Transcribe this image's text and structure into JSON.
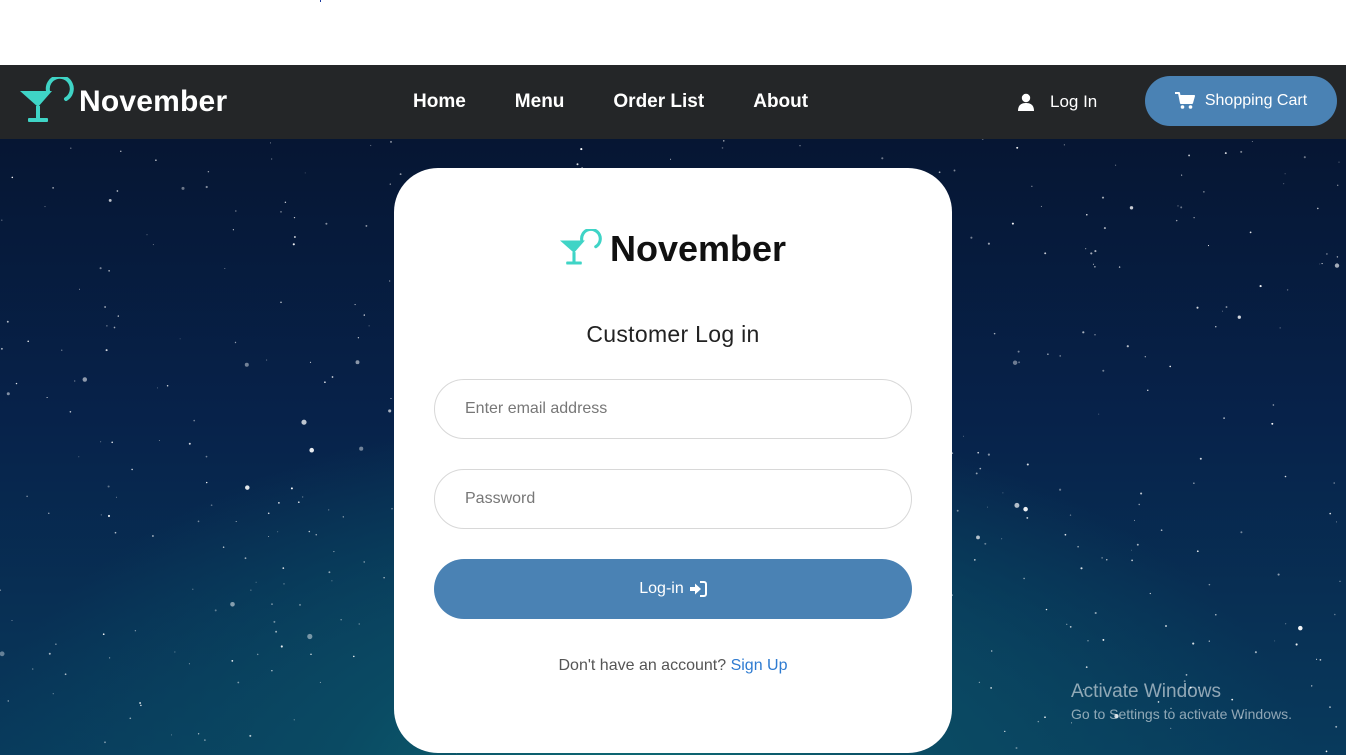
{
  "navbar": {
    "brand_name": "November",
    "links": [
      "Home",
      "Menu",
      "Order List",
      "About"
    ],
    "login_label": "Log In",
    "cart_label": "Shopping Cart"
  },
  "card": {
    "brand_name": "November",
    "title": "Customer Log in",
    "email_placeholder": "Enter email address",
    "password_placeholder": "Password",
    "submit_label": "Log-in",
    "signup_prompt": "Don't have an account?",
    "signup_link": "Sign Up"
  },
  "watermark": {
    "title": "Activate Windows",
    "subtitle": "Go to Settings to activate Windows."
  },
  "colors": {
    "brand_accent": "#3fd4c6",
    "navbar_bg": "#242628",
    "button_blue": "#4a82b4",
    "link_blue": "#2e7bd1"
  },
  "icons": {
    "brand": "cocktail-glass-icon",
    "login": "user-icon",
    "cart": "shopping-cart-icon",
    "submit": "sign-in-icon"
  }
}
